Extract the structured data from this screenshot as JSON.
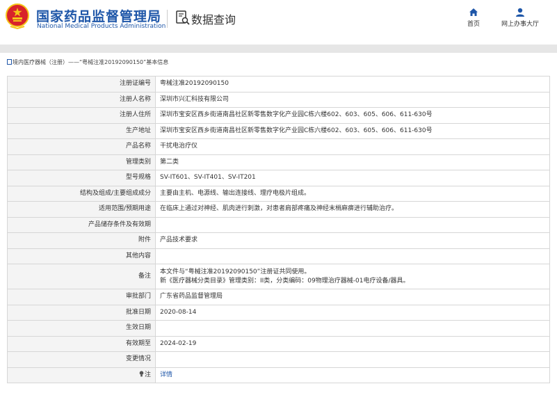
{
  "header": {
    "brand_cn": "国家药品监督管理局",
    "brand_en": "National Medical Products Administration",
    "query_title": "数据查询",
    "nav": [
      {
        "label": "首页",
        "icon": "home-icon"
      },
      {
        "label": "网上办事大厅",
        "icon": "user-icon"
      }
    ],
    "colors": {
      "brand": "#1e56a8",
      "emblem_red": "#d8232a",
      "emblem_gold": "#f5c518"
    }
  },
  "breadcrumb": "境内医疗器械（注册）——“粤械注准20192090150”基本信息",
  "record": [
    {
      "label": "注册证编号",
      "value": "粤械注准20192090150"
    },
    {
      "label": "注册人名称",
      "value": "深圳市兴汇科技有限公司"
    },
    {
      "label": "注册人住所",
      "value": "深圳市宝安区西乡街道南昌社区新零售数字化产业园C栋六楼602、603、605、606、611-630号"
    },
    {
      "label": "生产地址",
      "value": "深圳市宝安区西乡街道南昌社区新零售数字化产业园C栋六楼602、603、605、606、611-630号"
    },
    {
      "label": "产品名称",
      "value": "干扰电治疗仪"
    },
    {
      "label": "管理类别",
      "value": "第二类"
    },
    {
      "label": "型号规格",
      "value": "SV-IT601、SV-IT401、SV-IT201"
    },
    {
      "label": "结构及组成/主要组成成分",
      "value": "主要由主机、电源线、输出连接线、理疗电极片组成。"
    },
    {
      "label": "适用范围/预期用途",
      "value": "在临床上通过对神经、肌肉进行刺激，对患者肩部疼痛及神经末梢麻痹进行辅助治疗。"
    },
    {
      "label": "产品储存条件及有效期",
      "value": ""
    },
    {
      "label": "附件",
      "value": "产品技术要求"
    },
    {
      "label": "其他内容",
      "value": ""
    },
    {
      "label": "备注",
      "value": "",
      "lines": [
        "本文件与“粤械注准20192090150”注册证共同使用。",
        "新《医疗器械分类目录》管理类别：II类，分类编码：09物理治疗器械-01电疗设备/器具。"
      ]
    },
    {
      "label": "审批部门",
      "value": "广东省药品监督管理局"
    },
    {
      "label": "批准日期",
      "value": "2020-08-14"
    },
    {
      "label": "生效日期",
      "value": ""
    },
    {
      "label": "有效期至",
      "value": "2024-02-19"
    },
    {
      "label": "变更情况",
      "value": ""
    },
    {
      "label": "注",
      "value": "详情",
      "link": true,
      "icon": "lightbulb-icon"
    }
  ]
}
